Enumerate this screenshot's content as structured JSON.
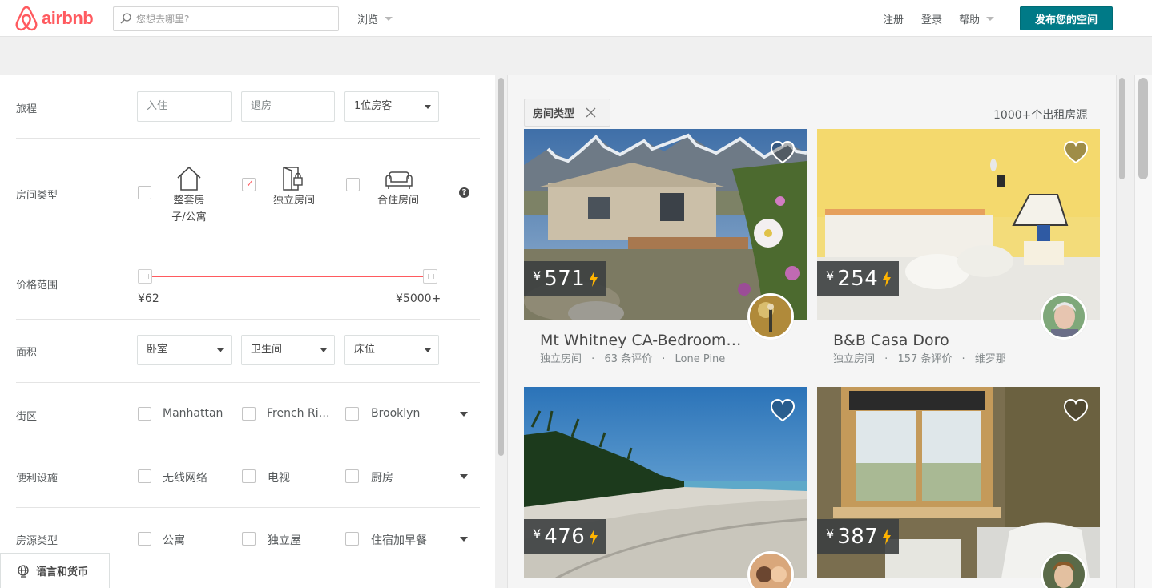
{
  "header": {
    "logo_text": "airbnb",
    "search_placeholder": "您想去哪里?",
    "browse_label": "浏览",
    "signup_label": "注册",
    "login_label": "登录",
    "help_label": "帮助",
    "host_button": "发布您的空间"
  },
  "filters": {
    "trip": {
      "label": "旅程",
      "checkin_placeholder": "入住",
      "checkout_placeholder": "退房",
      "guests_value": "1位房客"
    },
    "room_type": {
      "label": "房间类型",
      "options": [
        {
          "label_line1": "整套房",
          "label_line2": "子/公寓",
          "checked": false,
          "icon": "house-icon"
        },
        {
          "label_line1": "独立房间",
          "label_line2": "",
          "checked": true,
          "icon": "door-icon"
        },
        {
          "label_line1": "合住房间",
          "label_line2": "",
          "checked": false,
          "icon": "sofa-icon"
        }
      ],
      "help": "?"
    },
    "price": {
      "label": "价格范围",
      "min_label": "¥62",
      "max_label": "¥5000+"
    },
    "size": {
      "label": "面积",
      "bedrooms": "卧室",
      "bathrooms": "卫生间",
      "beds": "床位"
    },
    "neighborhoods": {
      "label": "街区",
      "options": [
        "Manhattan",
        "French Ri…",
        "Brooklyn"
      ]
    },
    "amenities": {
      "label": "便利设施",
      "options": [
        "无线网络",
        "电视",
        "厨房"
      ]
    },
    "property_type": {
      "label": "房源类型",
      "options": [
        "公寓",
        "独立屋",
        "住宿加早餐"
      ]
    }
  },
  "language_button": "语言和货币",
  "results": {
    "chip_label": "房间类型",
    "count_label": "1000+个出租房源",
    "listings": [
      {
        "currency": "¥",
        "price": "571",
        "title": "Mt Whitney CA-Bedroom…",
        "room_type": "独立房间",
        "dot1": "·",
        "reviews": "63 条评价",
        "dot2": "·",
        "location": "Lone Pine"
      },
      {
        "currency": "¥",
        "price": "254",
        "title": "B&B Casa Doro",
        "room_type": "独立房间",
        "dot1": "·",
        "reviews": "157 条评价",
        "dot2": "·",
        "location": "维罗那"
      },
      {
        "currency": "¥",
        "price": "476"
      },
      {
        "currency": "¥",
        "price": "387"
      }
    ]
  },
  "colors": {
    "brand": "#ff5a5f",
    "host_button": "#007a87",
    "bolt": "#ffb400"
  }
}
